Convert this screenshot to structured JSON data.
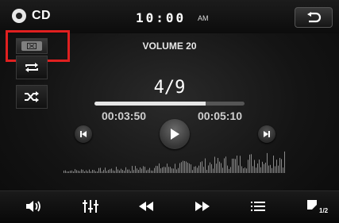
{
  "header": {
    "source_label": "CD",
    "time": "10:00",
    "ampm": "AM"
  },
  "volume_text": "VOLUME 20",
  "track_text": "4/9",
  "progress": {
    "elapsed": "00:03:50",
    "total": "00:05:10",
    "fraction": 0.74
  },
  "bottom": {
    "page_indicator": "1/2"
  },
  "colors": {
    "highlight": "#e02020",
    "bar_fill": "#e6e6e6"
  }
}
